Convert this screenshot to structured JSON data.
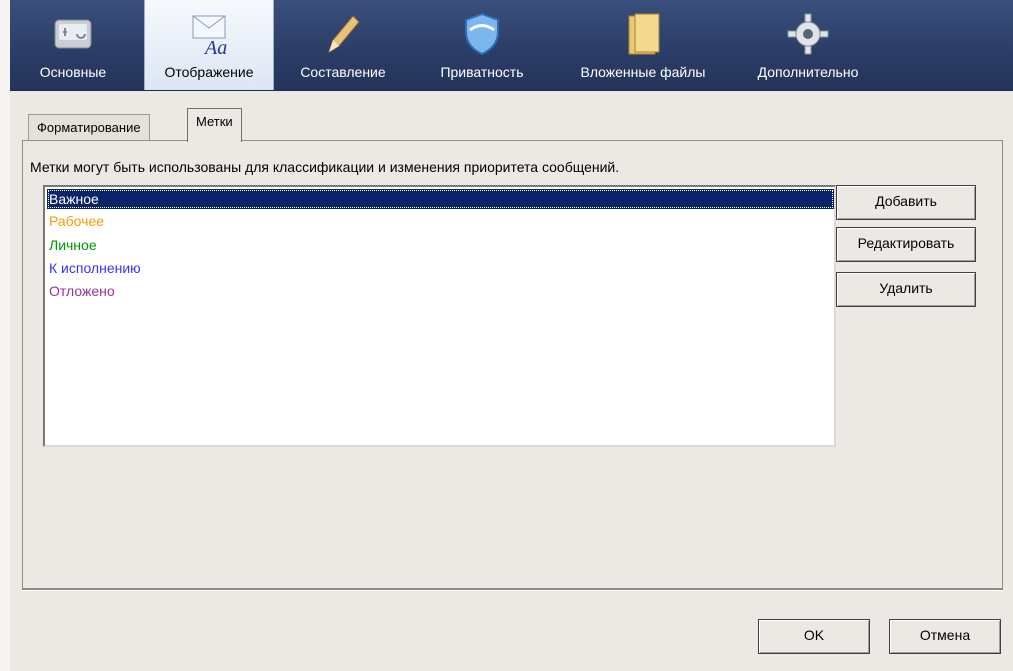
{
  "toolbar": {
    "items": [
      {
        "label": "Основные",
        "icon": "general-icon"
      },
      {
        "label": "Отображение",
        "icon": "display-icon"
      },
      {
        "label": "Составление",
        "icon": "compose-pencil-icon"
      },
      {
        "label": "Приватность",
        "icon": "privacy-shield-icon"
      },
      {
        "label": "Вложенные файлы",
        "icon": "attachments-folder-icon"
      },
      {
        "label": "Дополнительно",
        "icon": "advanced-gear-icon"
      }
    ],
    "active_index": 1
  },
  "tabs": [
    {
      "label": "Форматирование",
      "active": false
    },
    {
      "label": "Метки",
      "active": true
    }
  ],
  "panel": {
    "description": "Метки могут быть использованы для классификации и изменения приоритета сообщений."
  },
  "labels": [
    {
      "text": "Важное",
      "color": "#ffffff",
      "selected": true
    },
    {
      "text": "Рабочее",
      "color": "#ff9900",
      "selected": false
    },
    {
      "text": "Личное",
      "color": "#009900",
      "selected": false
    },
    {
      "text": "К исполнению",
      "color": "#3333ff",
      "selected": false
    },
    {
      "text": "Отложено",
      "color": "#993399",
      "selected": false
    }
  ],
  "buttons": {
    "add": "Добавить",
    "edit": "Редактировать",
    "delete": "Удалить",
    "ok": "OK",
    "cancel": "Отмена"
  }
}
